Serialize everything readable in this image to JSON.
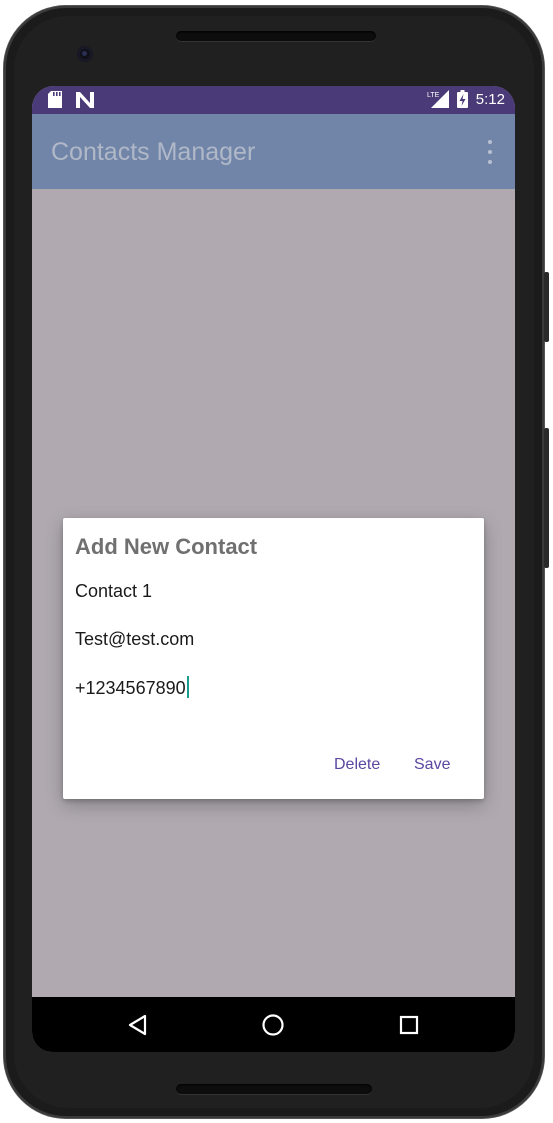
{
  "status_bar": {
    "time": "5:12",
    "network": "LTE",
    "left_icons": [
      "sd-card-icon",
      "n-notification-icon"
    ],
    "right_icons": [
      "lte-signal-icon",
      "battery-charging-icon"
    ]
  },
  "app_bar": {
    "title": "Contacts Manager",
    "menu_icon": "overflow-menu-icon"
  },
  "dialog": {
    "title": "Add New Contact",
    "name_value": "Contact 1",
    "email_value": "Test@test.com",
    "phone_value": "+1234567890",
    "delete_label": "Delete",
    "save_label": "Save"
  },
  "fab": {
    "icon": "mail-icon"
  },
  "navigation": {
    "back_icon": "back-triangle-icon",
    "home_icon": "home-circle-icon",
    "recents_icon": "recents-square-icon"
  },
  "colors": {
    "status_bar": "#4b3a78",
    "app_bar": "#7185a9",
    "scrim_background": "#b0aab0",
    "accent": "#5b47a0",
    "fab": "#b3a9c7",
    "cursor": "#1a9c8e"
  }
}
